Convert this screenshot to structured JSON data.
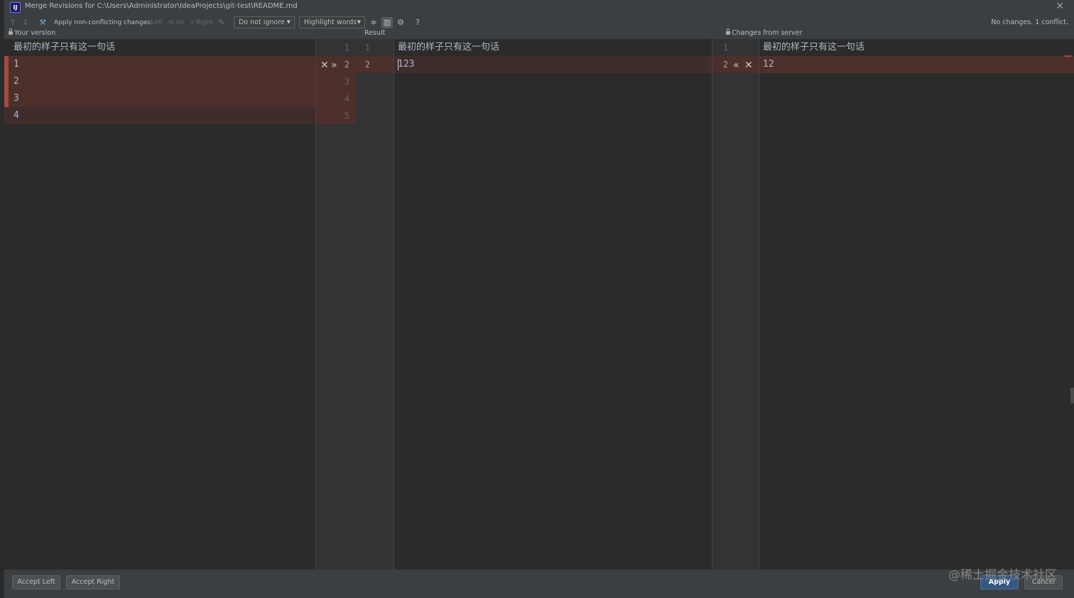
{
  "window": {
    "title": "Merge Revisions for C:\\Users\\Administrator\\IdeaProjects\\git-test\\README.md",
    "app_icon": "IJ"
  },
  "toolbar": {
    "apply_label": "Apply non-conflicting changes:",
    "left_label": "Left",
    "all_label": "All",
    "right_label": "Right",
    "ignore_dropdown": "Do not ignore",
    "highlight_dropdown": "Highlight words",
    "help_label": "?"
  },
  "status": "No changes. 1 conflict.",
  "headers": {
    "left": "Your version",
    "center": "Result",
    "right": "Changes from server"
  },
  "left_pane": {
    "lines": [
      "最初的样子只有这一句话",
      "1",
      "2",
      "3",
      "4"
    ]
  },
  "left_gutter": {
    "numbers": [
      "1",
      "2",
      "3",
      "4",
      "5"
    ]
  },
  "center_gutter": {
    "numbers": [
      "1",
      "2"
    ]
  },
  "center_pane": {
    "lines": [
      "最初的样子只有这一句话",
      "123"
    ]
  },
  "right_gutter": {
    "numbers": [
      "1",
      "2"
    ]
  },
  "right_pane": {
    "lines": [
      "最初的样子只有这一句话",
      "12"
    ]
  },
  "buttons": {
    "accept_left": "Accept Left",
    "accept_right": "Accept Right",
    "apply": "Apply",
    "cancel": "Cancel"
  },
  "watermark": "@稀土掘金技术社区",
  "colors": {
    "conflict": "#4d2f2c",
    "conflict_marker": "#a54a3e",
    "editor_bg": "#2b2b2b",
    "gutter_bg": "#313335",
    "primary_button": "#365880"
  }
}
